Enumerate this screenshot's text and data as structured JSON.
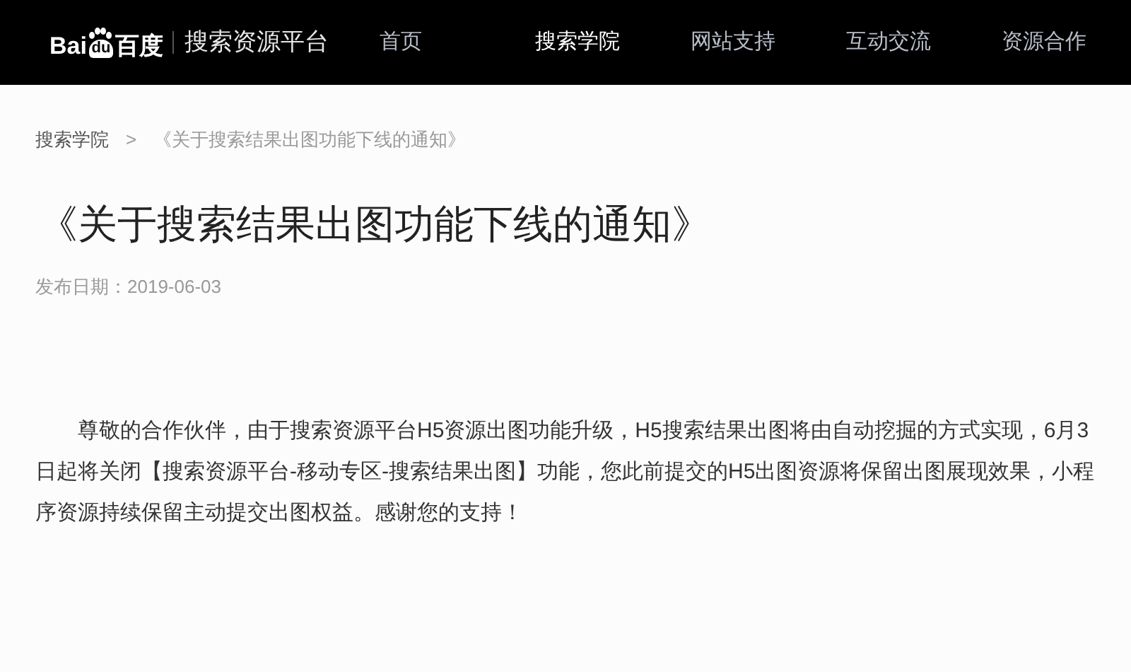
{
  "header": {
    "logo": {
      "latin_start": "Bai",
      "latin_end": "du",
      "cjk": "百度"
    },
    "platform_name": "搜索资源平台",
    "nav": [
      {
        "label": "首页",
        "selected": false
      },
      {
        "label": "搜索学院",
        "selected": true
      },
      {
        "label": "网站支持",
        "selected": false
      },
      {
        "label": "互动交流",
        "selected": false
      },
      {
        "label": "资源合作",
        "selected": false
      }
    ]
  },
  "breadcrumb": {
    "items": [
      "搜索学院",
      "《关于搜索结果出图功能下线的通知》"
    ],
    "separator": ">"
  },
  "article": {
    "title": "《关于搜索结果出图功能下线的通知》",
    "date": "发布日期：2019-06-03",
    "body": "尊敬的合作伙伴，由于搜索资源平台H5资源出图功能升级，H5搜索结果出图将由自动挖掘的方式实现，6月3日起将关闭【搜索资源平台-移动专区-搜索结果出图】功能，您此前提交的H5出图资源将保留出图展现效果，小程序资源持续保留主动提交出图权益。感谢您的支持！"
  }
}
